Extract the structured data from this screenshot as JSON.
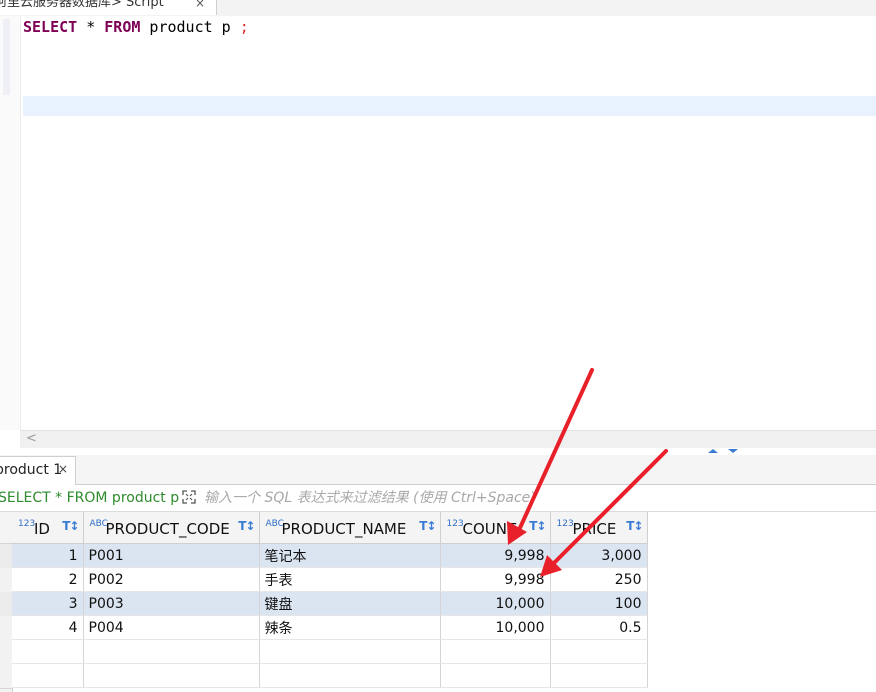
{
  "editor_tab": {
    "title": "阿里云服务器数据库> Script",
    "close": "×"
  },
  "editor": {
    "sql": {
      "kw1": "SELECT",
      "mid1": " * ",
      "kw2": "FROM",
      "mid2": " product p ",
      "semi": ";"
    }
  },
  "scrollbar": {
    "left_arrow": "<"
  },
  "results_tab": {
    "title": "product 1",
    "close": "×"
  },
  "filter": {
    "query_text": "SELECT * FROM product p",
    "placeholder": "输入一个 SQL 表达式来过滤结果 (使用 Ctrl+Space)"
  },
  "grid": {
    "columns": [
      {
        "type": "123",
        "name": "ID"
      },
      {
        "type": "ABC",
        "name": "PRODUCT_CODE"
      },
      {
        "type": "ABC",
        "name": "PRODUCT_NAME"
      },
      {
        "type": "123",
        "name": "COUNT"
      },
      {
        "type": "123",
        "name": "PRICE"
      }
    ],
    "filter_glyph": "T↕",
    "rows": [
      {
        "id": "1",
        "code": "P001",
        "name": "笔记本",
        "count": "9,998",
        "price": "3,000"
      },
      {
        "id": "2",
        "code": "P002",
        "name": "手表",
        "count": "9,998",
        "price": "250"
      },
      {
        "id": "3",
        "code": "P003",
        "name": "键盘",
        "count": "10,000",
        "price": "100"
      },
      {
        "id": "4",
        "code": "P004",
        "name": "辣条",
        "count": "10,000",
        "price": "0.5"
      }
    ]
  },
  "colors": {
    "keyword": "#7f0055",
    "selected_row": "#dbe5f1",
    "annotation_arrow": "#e8202a",
    "filter_text": "#2e8b2e"
  }
}
